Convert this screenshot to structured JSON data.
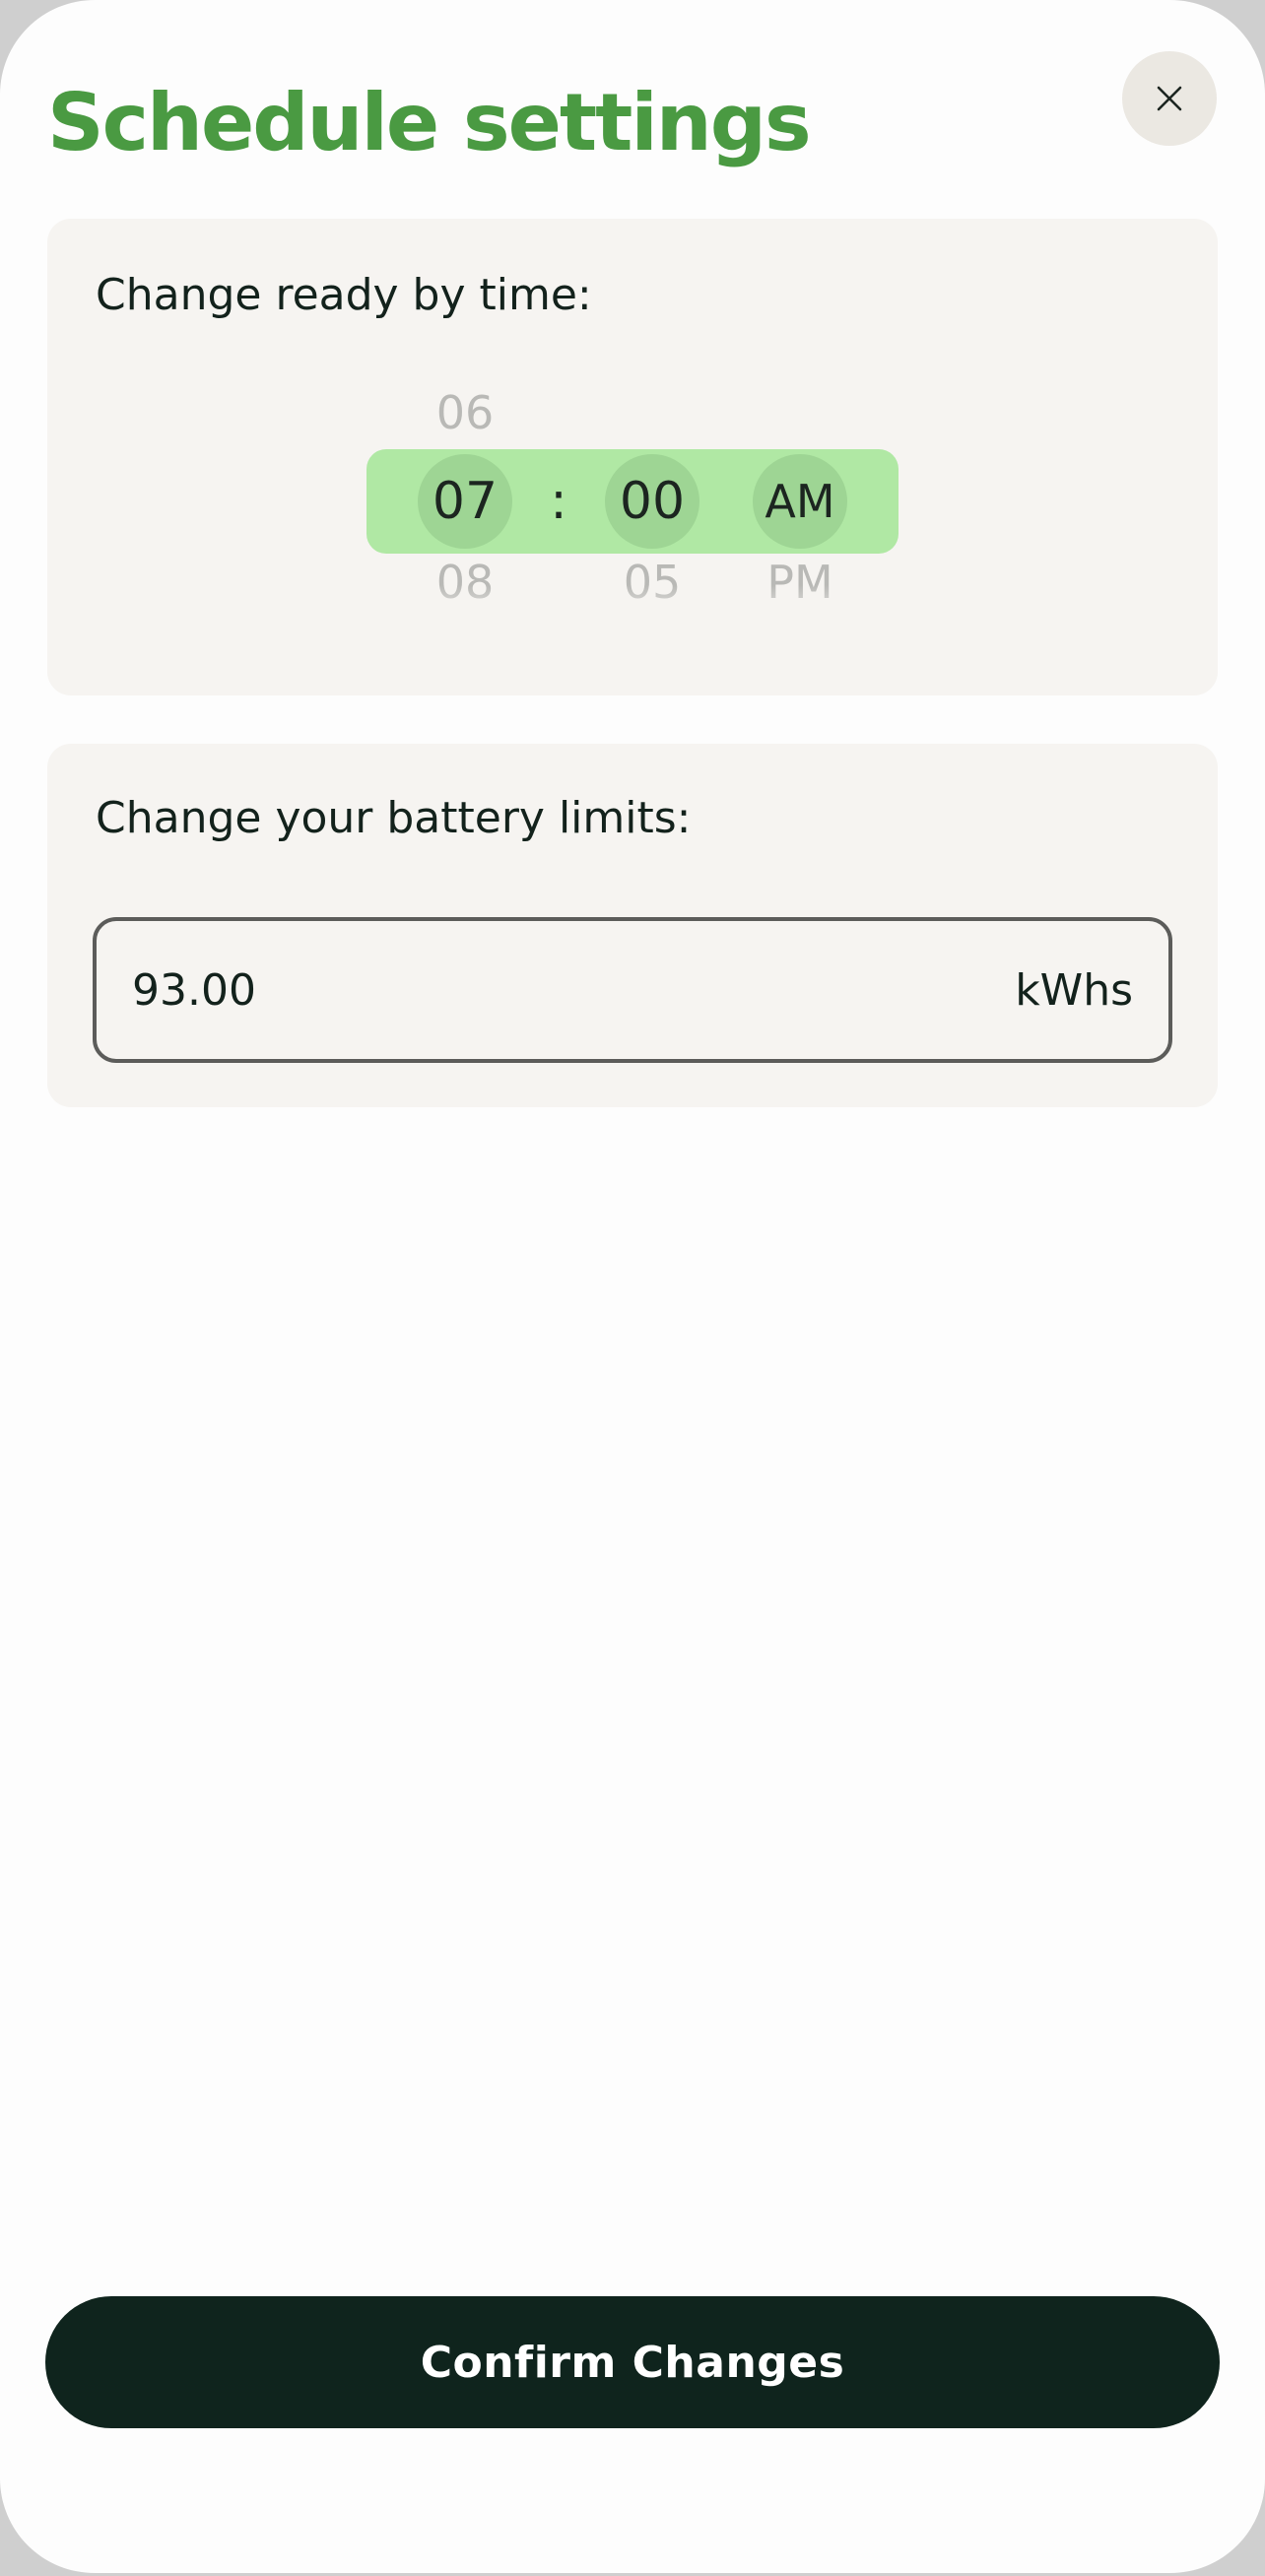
{
  "header": {
    "title": "Schedule settings",
    "close_icon": "close-icon"
  },
  "ready_time": {
    "label": "Change ready by time:",
    "hour_prev": "06",
    "hour": "07",
    "hour_next": "08",
    "separator": ":",
    "minute": "00",
    "minute_next": "05",
    "period": "AM",
    "period_next": "PM"
  },
  "battery": {
    "label": "Change your battery limits:",
    "value": "93.00",
    "unit": "kWhs"
  },
  "footer": {
    "confirm_label": "Confirm Changes"
  },
  "colors": {
    "title_green": "#4a9a42",
    "picker_bg": "#b0e8a4",
    "button_dark": "#0f241d"
  }
}
